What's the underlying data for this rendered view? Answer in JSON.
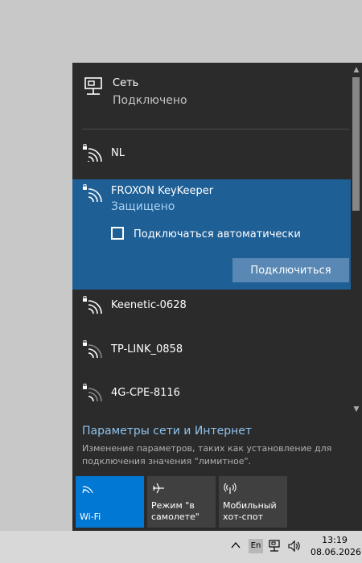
{
  "network": {
    "title": "Сеть",
    "status": "Подключено"
  },
  "wifi_list": [
    {
      "name": "NL"
    },
    {
      "name": "Keenetic-0628"
    },
    {
      "name": "TP-LINK_0858"
    },
    {
      "name": "4G-CPE-8116"
    }
  ],
  "selected_wifi": {
    "name": "FROXON KeyKeeper",
    "security": "Защищено",
    "auto_connect_label": "Подключаться автоматически",
    "auto_connect_checked": false,
    "connect_button": "Подключиться"
  },
  "settings": {
    "link": "Параметры сети и Интернет",
    "description": "Изменение параметров, таких как установление для подключения значения \"лимитное\"."
  },
  "tiles": [
    {
      "label": "Wi-Fi",
      "icon": "wifi-icon",
      "active": true
    },
    {
      "label": "Режим \"в самолете\"",
      "icon": "airplane-icon",
      "active": false
    },
    {
      "label": "Мобильный хот-спот",
      "icon": "hotspot-icon",
      "active": false
    }
  ],
  "taskbar": {
    "language": "En",
    "time": "13:19",
    "date": "08.06.2026"
  },
  "colors": {
    "accent": "#0078d4",
    "selected_bg": "#1e5f96",
    "flyout_bg": "#2b2b2b",
    "link": "#8ec3f0"
  }
}
